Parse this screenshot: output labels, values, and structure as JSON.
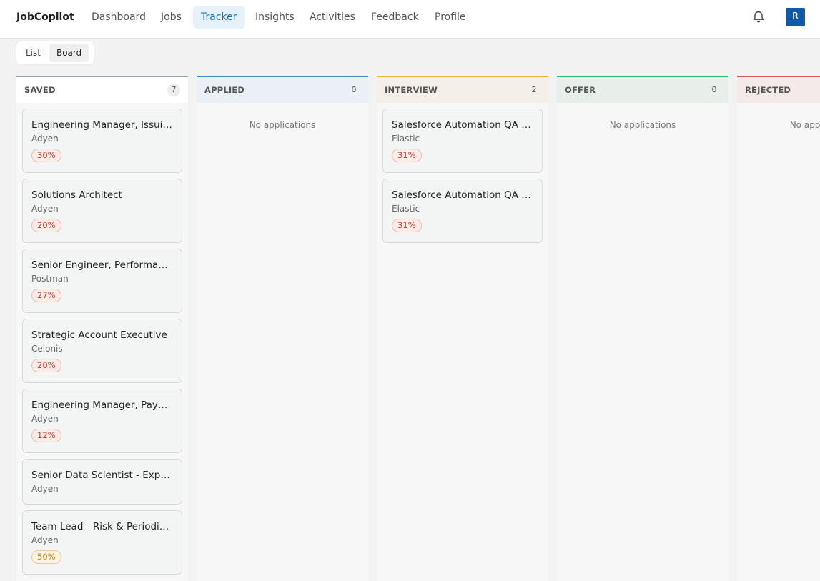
{
  "header": {
    "brand": "JobCopilot",
    "nav": [
      "Dashboard",
      "Jobs",
      "Tracker",
      "Insights",
      "Activities",
      "Feedback",
      "Profile"
    ],
    "active_nav": "Tracker",
    "avatar_initial": "R"
  },
  "view_toggle": {
    "list_label": "List",
    "board_label": "Board",
    "active": "Board"
  },
  "columns": {
    "saved": {
      "title": "SAVED",
      "count": "7",
      "cards": [
        {
          "title": "Engineering Manager, Issuing",
          "company": "Adyen",
          "match": "30%"
        },
        {
          "title": "Solutions Architect",
          "company": "Adyen",
          "match": "20%"
        },
        {
          "title": "Senior Engineer, Performance",
          "company": "Postman",
          "match": "27%"
        },
        {
          "title": "Strategic Account Executive",
          "company": "Celonis",
          "match": "20%"
        },
        {
          "title": "Engineering Manager, Payments",
          "company": "Adyen",
          "match": "12%"
        },
        {
          "title": "Senior Data Scientist - Experimentation",
          "company": "Adyen",
          "match": ""
        },
        {
          "title": "Team Lead - Risk & Periodic Review",
          "company": "Adyen",
          "match": "50%"
        }
      ]
    },
    "applied": {
      "title": "APPLIED",
      "count": "0",
      "empty_text": "No applications"
    },
    "interview": {
      "title": "INTERVIEW",
      "count": "2",
      "cards": [
        {
          "title": "Salesforce Automation QA Analyst",
          "company": "Elastic",
          "match": "31%"
        },
        {
          "title": "Salesforce Automation QA Analyst",
          "company": "Elastic",
          "match": "31%"
        }
      ]
    },
    "offer": {
      "title": "OFFER",
      "count": "0",
      "empty_text": "No applications"
    },
    "rejected": {
      "title": "REJECTED",
      "empty_text": "No applications"
    }
  },
  "colors": {
    "saved": "#9aa0a8",
    "applied": "#3b8fd9",
    "interview": "#f0b429",
    "offer": "#23c16b",
    "rejected": "#e05a5a",
    "avatar_bg": "#0f5aa8",
    "active_nav": "#1c6fb4"
  },
  "icons": {
    "notifications": "bell-icon"
  }
}
